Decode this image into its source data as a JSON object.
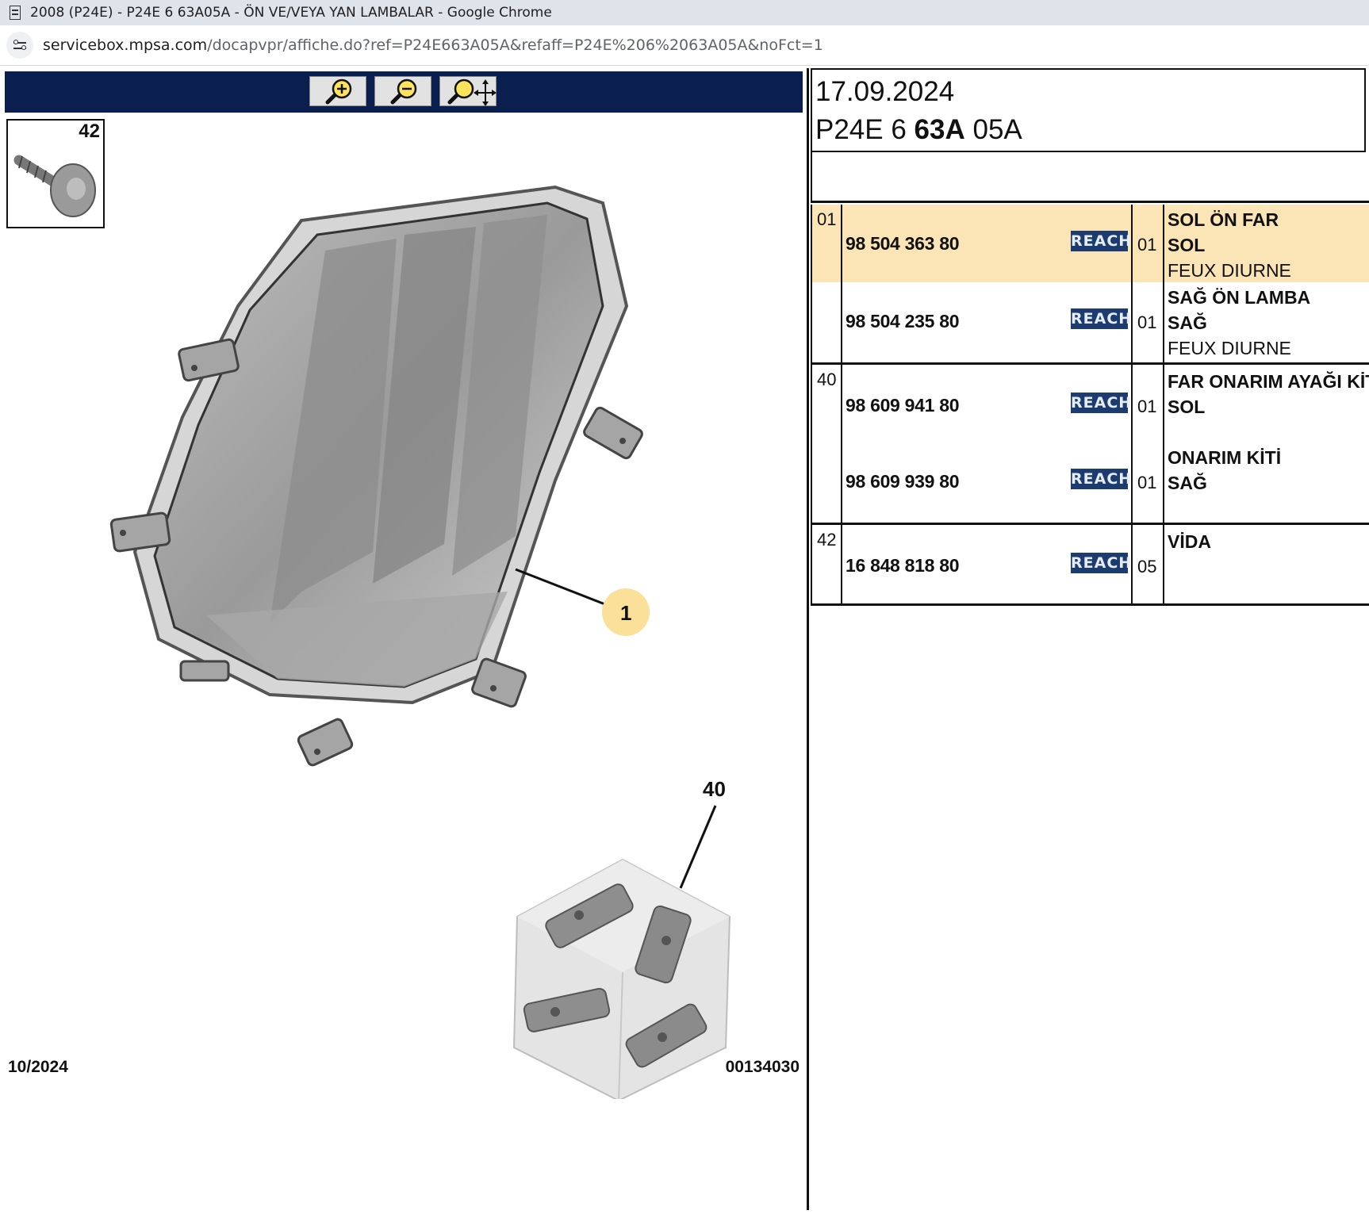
{
  "window": {
    "title": "2008 (P24E) - P24E 6 63A05A - ÖN VE/VEYA YAN LAMBALAR - Google Chrome"
  },
  "address_bar": {
    "url_host": "servicebox.mpsa.com",
    "url_path": "/docapvpr/affiche.do?ref=P24E663A05A&refaff=P24E%206%2063A05A&noFct=1"
  },
  "toolbar": {
    "buttons": [
      {
        "icon": "zoom-in-icon"
      },
      {
        "icon": "zoom-out-icon"
      },
      {
        "icon": "zoom-pan-icon"
      }
    ],
    "background": "#0a1f4d"
  },
  "illustration": {
    "thumb_label": "42",
    "callout_1": "1",
    "callout_40": "40",
    "callout_color": "#fbe09a",
    "footer_date": "10/2024",
    "footer_ref": "00134030"
  },
  "header": {
    "date": "17.09.2024",
    "code_prefix": "P24E 6",
    "code_bold": "63A",
    "code_suffix": "05A"
  },
  "parts": {
    "highlight_color": "#fbe5b6",
    "reach_label": "REACH",
    "rows": [
      {
        "ref": "01",
        "part_no": "98 504 363 80",
        "qty": "01",
        "desc1": "SOL ÖN FAR",
        "desc2": "SOL",
        "desc3": "FEUX DIURNE"
      },
      {
        "ref": "",
        "part_no": "98 504 235 80",
        "qty": "01",
        "desc1": "SAĞ ÖN LAMBA",
        "desc2": "SAĞ",
        "desc3": "FEUX DIURNE"
      },
      {
        "ref": "40",
        "part_no": "98 609 941 80",
        "qty": "01",
        "desc1": "FAR ONARIM AYAĞI KİT",
        "desc2": "SOL",
        "desc3": ""
      },
      {
        "ref": "",
        "part_no": "98 609 939 80",
        "qty": "01",
        "desc1": "ONARIM KİTİ",
        "desc2": "SAĞ",
        "desc3": ""
      },
      {
        "ref": "42",
        "part_no": "16 848 818 80",
        "qty": "05",
        "desc1": "VİDA",
        "desc2": "",
        "desc3": ""
      }
    ]
  }
}
